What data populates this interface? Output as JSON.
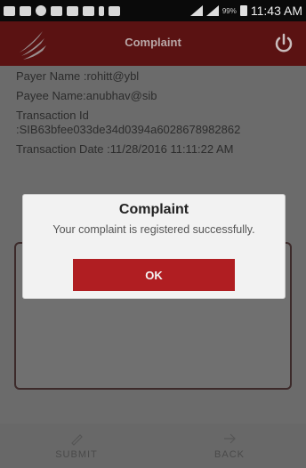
{
  "status_bar": {
    "battery_percent": "99%",
    "time": "11:43 AM"
  },
  "app_bar": {
    "title": "Complaint"
  },
  "details": {
    "payer": "Payer Name :rohitt@ybl",
    "payee": "Payee Name:anubhav@sib",
    "txn_id_label": "Transaction Id",
    "txn_id_value": ":SIB63bfee033de34d0394a6028678982862",
    "txn_date": "Transaction Date :11/28/2016 11:11:22 AM"
  },
  "dialog": {
    "title": "Complaint",
    "message": "Your complaint is registered successfully.",
    "ok_label": "OK"
  },
  "bottom_bar": {
    "submit_label": "SUBMIT",
    "back_label": "BACK"
  },
  "colors": {
    "app_bar": "#5a1212",
    "ok_button": "#b01e22"
  }
}
